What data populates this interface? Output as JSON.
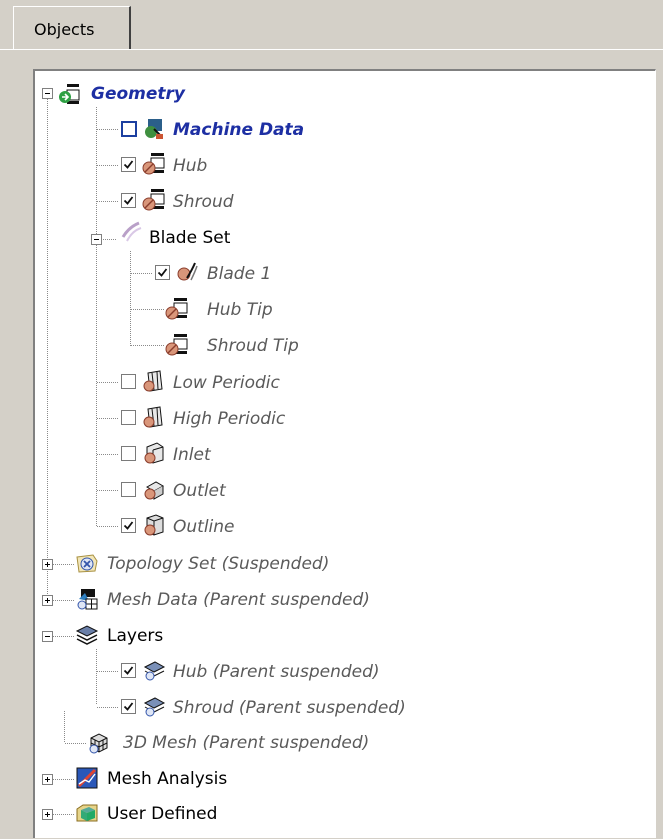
{
  "tabs": [
    {
      "label": "Objects"
    }
  ],
  "tree": {
    "geometry": {
      "label": "Geometry",
      "children": [
        {
          "label": "Machine Data",
          "checked": false
        },
        {
          "label": "Hub",
          "checked": true
        },
        {
          "label": "Shroud",
          "checked": true
        }
      ],
      "blade_set": {
        "label": "Blade Set",
        "children": [
          {
            "label": "Blade 1",
            "checked": true
          },
          {
            "label": "Hub Tip"
          },
          {
            "label": "Shroud Tip"
          }
        ]
      },
      "after_blade": [
        {
          "label": "Low Periodic",
          "checked": false
        },
        {
          "label": "High Periodic",
          "checked": false
        },
        {
          "label": "Inlet",
          "checked": false
        },
        {
          "label": "Outlet",
          "checked": false
        },
        {
          "label": "Outline",
          "checked": true
        }
      ]
    },
    "topology_set": {
      "label": "Topology Set (Suspended)"
    },
    "mesh_data": {
      "label": "Mesh Data (Parent suspended)"
    },
    "layers": {
      "label": "Layers",
      "children": [
        {
          "label": "Hub (Parent suspended)",
          "checked": true
        },
        {
          "label": "Shroud (Parent suspended)",
          "checked": true
        }
      ]
    },
    "mesh_3d": {
      "label": "3D Mesh (Parent suspended)"
    },
    "mesh_analysis": {
      "label": "Mesh Analysis"
    },
    "user_defined": {
      "label": "User Defined"
    }
  },
  "icons": {
    "geometry": "geometry-icon",
    "machine_data": "machine-data-icon",
    "surface": "surface-icon",
    "blade_set": "blade-set-icon",
    "blade": "blade-icon",
    "periodic": "periodic-icon",
    "inlet": "inlet-icon",
    "outlet": "outlet-icon",
    "outline": "outline-icon",
    "topology": "topology-icon",
    "mesh_data": "mesh-data-icon",
    "layers": "layers-icon",
    "layer": "layer-icon",
    "mesh_3d": "mesh-3d-icon",
    "mesh_analysis": "mesh-analysis-icon",
    "user_defined": "user-defined-icon"
  },
  "colors": {
    "geometry_label": "#1d2fa3",
    "suspended_label": "#5a5a5a",
    "panel_background": "#d4d0c8"
  }
}
